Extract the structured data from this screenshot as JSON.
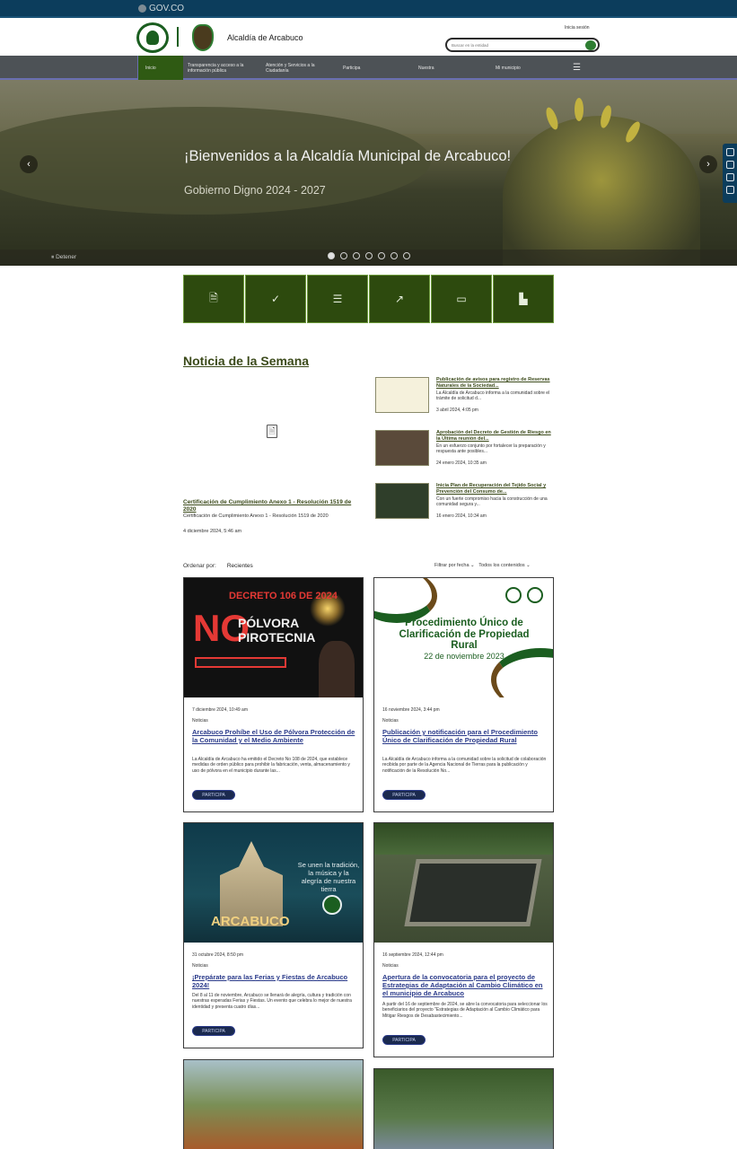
{
  "gov_bar": {
    "logo_text": "GOV.CO"
  },
  "header": {
    "site_name": "Alcaldía de Arcabuco",
    "login": "Inicia sesión",
    "search_placeholder": "Buscar en la entidad"
  },
  "nav": {
    "items": [
      {
        "label": "Inicio"
      },
      {
        "label": "Transparencia y acceso a la información pública"
      },
      {
        "label": "Atención y Servicios a la Ciudadanía"
      },
      {
        "label": "Participa"
      },
      {
        "label": "Nuestra"
      },
      {
        "label": "Mi municipio"
      }
    ],
    "menu_icon": "hamburger-icon"
  },
  "hero": {
    "title": "¡Bienvenidos a la Alcaldía Municipal de Arcabuco!",
    "subtitle": "Gobierno Digno 2024 - 2027",
    "stop_label": "Detener",
    "prev_icon": "‹",
    "next_icon": "›",
    "slides": 7,
    "active_slide": 1
  },
  "quick_links": [
    {
      "icon": "document-icon",
      "glyph": "🗎"
    },
    {
      "icon": "check-icon",
      "glyph": "✓"
    },
    {
      "icon": "list-icon",
      "glyph": "☰"
    },
    {
      "icon": "trend-icon",
      "glyph": "↗"
    },
    {
      "icon": "calendar-icon",
      "glyph": "▭"
    },
    {
      "icon": "chart-icon",
      "glyph": "▙"
    }
  ],
  "weekly_news": {
    "section_title": "Noticia de la Semana",
    "featured": {
      "title": "Certificación de Cumplimiento Anexo 1 - Resolución 1519 de 2020",
      "description": "Certificación de Cumplimiento Anexo 1 - Resolución 1519 de 2020",
      "date": "4 diciembre 2024, 5:46 am"
    },
    "side": [
      {
        "title": "Publicación de avisos para registro de Reservas Naturales de la Sociedad...",
        "description": "La Alcaldía de Arcabuco informa a la comunidad sobre el trámite de solicitud d...",
        "date": "3 abril 2024, 4:05 pm"
      },
      {
        "title": "Aprobación del Decreto de Gestión de Riesgo en la Última reunión del...",
        "description": "En un esfuerzo conjunto por fortalecer la preparación y respuesta ante posibles...",
        "date": "24 enero 2024, 10:35 am"
      },
      {
        "title": "Inicia Plan de Recuperación del Tejido Social y Prevención del Consumo de...",
        "description": "Con un fuerte compromiso hacia la construcción de una comunidad segura y...",
        "date": "16 enero 2024, 10:34 am"
      }
    ]
  },
  "listing": {
    "order_label": "Ordenar por:",
    "order_value": "Recientes",
    "filter_date": "Filtrar por fecha",
    "filter_content": "Todos los contenidos"
  },
  "cards": [
    {
      "date": "7 diciembre 2024, 10:49 am",
      "tag": "Noticias",
      "title": "Arcabuco Prohíbe el Uso de Pólvora Protección de la Comunidad y el Medio Ambiente",
      "description": "La Alcaldía de Arcabuco ha emitido el Decreto No 108 de 2024, que establece medidas de orden público para prohibir la fabricación, venta, almacenamiento y uso de pólvora en el municipio durante las...",
      "button": "PARTICIPA",
      "image": {
        "decreto": "DECRETO 106 DE 2024",
        "no": "NO",
        "polvora": "PÓLVORA",
        "pirotecnia": "PIROTECNIA"
      }
    },
    {
      "date": "16 noviembre 2024, 3:44 pm",
      "tag": "Noticias",
      "title": "Publicación y notificación para el Procedimiento Único de Clarificación de Propiedad Rural",
      "description": "La Alcaldía de Arcabuco informa a la comunidad sobre la solicitud de colaboración recibida por parte de la Agencia Nacional de Tierras para la publicación y notificación de la Resolución No...",
      "button": "PARTICIPA",
      "image": {
        "title": "Procedimiento Único de Clarificación de Propiedad Rural",
        "date": "22 de noviembre 2023"
      }
    },
    {
      "date": "31 octubre 2024, 8:50 pm",
      "tag": "Noticias",
      "title": "¡Prepárate para las Ferias y Fiestas de Arcabuco 2024!",
      "description": "Del 8 al 11 de noviembre, Arcabuco se llenará de alegría, cultura y tradición con nuestras esperadas Ferias y Fiestas. Un evento que celebra lo mejor de nuestra identidad y presenta cuatro días...",
      "button": "PARTICIPA",
      "image": {
        "text": "Se unen la tradición, la música y la alegría de nuestra tierra",
        "town": "ARCABUCO"
      }
    },
    {
      "date": "16 septiembre 2024, 12:44 pm",
      "tag": "Noticias",
      "title": "Apertura de la convocatoria para el proyecto de Estrategias de Adaptación al Cambio Climático en el municipio de Arcabuco",
      "description": "A partir del 16 de septiembre de 2024, se abre la convocatoria para seleccionar los beneficiarios del proyecto \"Estrategias de Adaptación al Cambio Climático para Mitigar Riesgos de Desabastecimiento...",
      "button": "PARTICIPA"
    }
  ]
}
